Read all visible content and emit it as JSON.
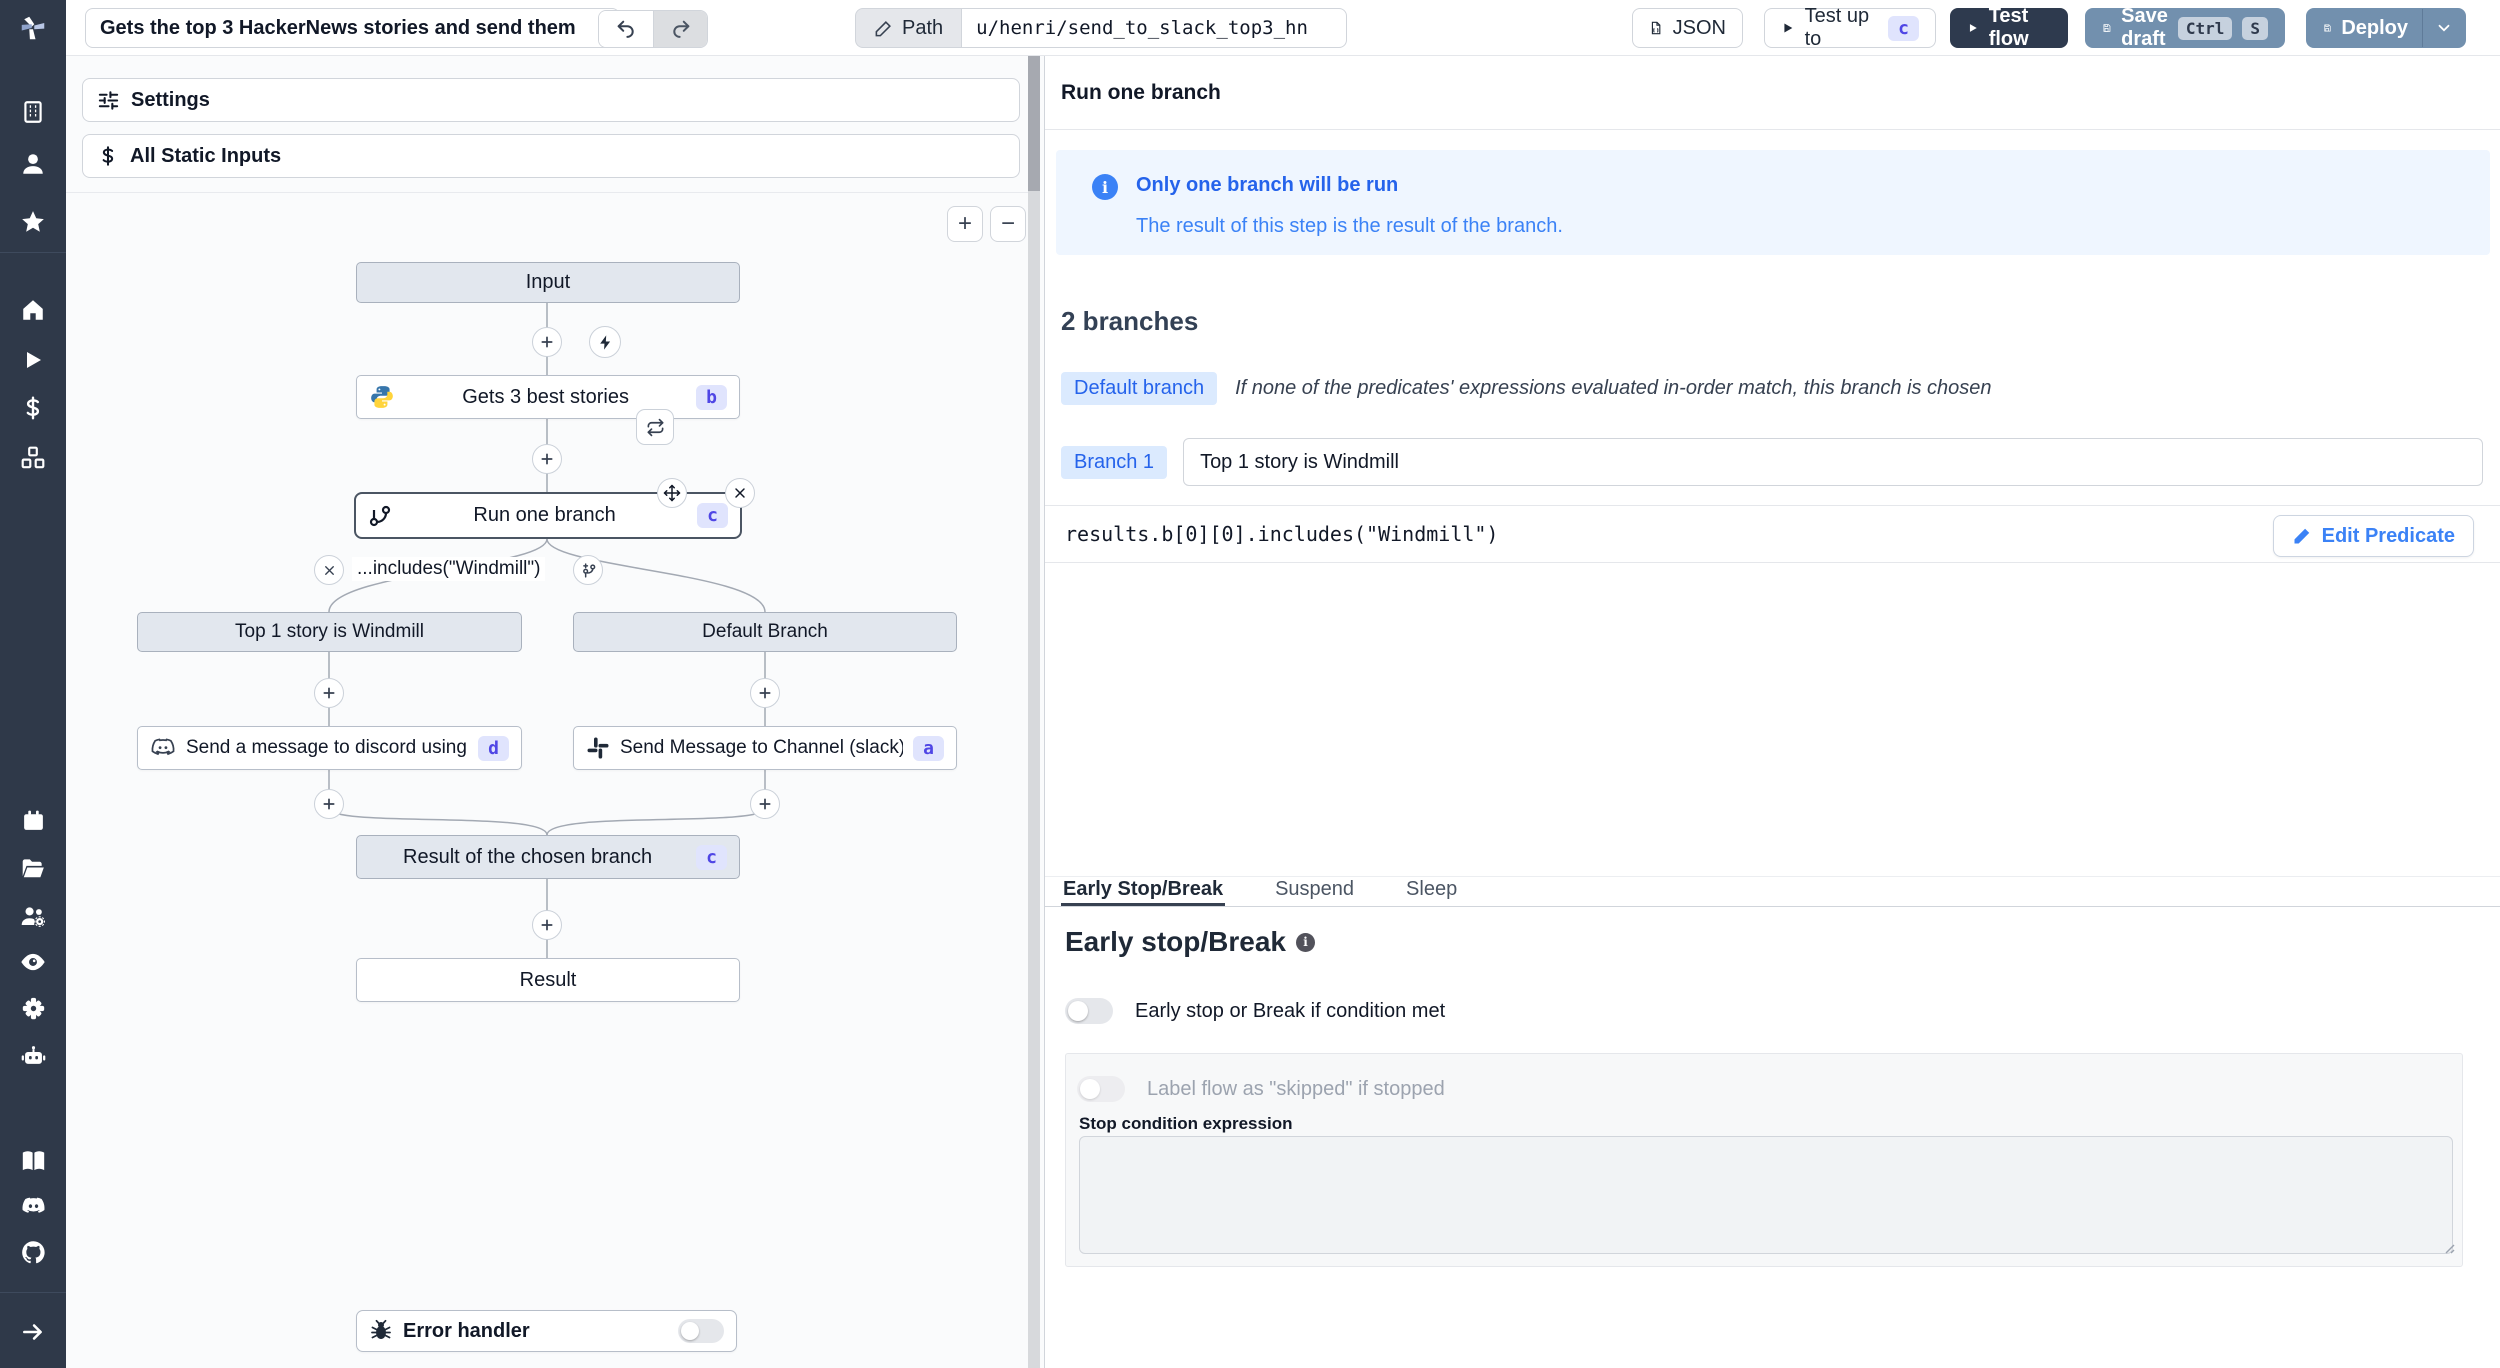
{
  "topbar": {
    "title_value": "Gets the top 3 HackerNews stories and send them",
    "path_label": "Path",
    "path_value": "u/henri/send_to_slack_top3_hn",
    "json_label": "JSON",
    "test_up_to_label": "Test up to",
    "test_up_to_badge": "c",
    "test_flow_label": "Test flow",
    "save_draft_label": "Save draft",
    "kbd_ctrl": "Ctrl",
    "kbd_s": "S",
    "deploy_label": "Deploy"
  },
  "flow": {
    "settings_label": "Settings",
    "static_inputs_label": "All Static Inputs",
    "zoom_in": "+",
    "zoom_out": "−",
    "edge_label": "...includes(\"Windmill\")",
    "error_handler_label": "Error handler",
    "nodes": {
      "input": {
        "label": "Input"
      },
      "get_stories": {
        "label": "Gets 3 best stories",
        "badge": "b"
      },
      "run_one_branch": {
        "label": "Run one branch",
        "badge": "c"
      },
      "branch_windmill": {
        "label": "Top 1 story is Windmill"
      },
      "branch_default": {
        "label": "Default Branch"
      },
      "discord": {
        "label": "Send a message to discord using w...",
        "badge": "d"
      },
      "slack": {
        "label": "Send Message to Channel (slack)",
        "badge": "a"
      },
      "result_chosen": {
        "label": "Result of the chosen branch",
        "badge": "c"
      },
      "result": {
        "label": "Result"
      }
    }
  },
  "panel": {
    "title": "Run one branch",
    "info": {
      "title": "Only one branch will be run",
      "body": "The result of this step is the result of the branch."
    },
    "branches_heading": "2 branches",
    "default_branch": {
      "badge": "Default branch",
      "desc": "If none of the predicates' expressions evaluated in-order match, this branch is chosen"
    },
    "branch1": {
      "badge": "Branch 1",
      "value": "Top 1 story is Windmill"
    },
    "predicate": {
      "code": "results.b[0][0].includes(\"Windmill\")",
      "edit_label": "Edit Predicate"
    },
    "tabs": {
      "early": "Early Stop/Break",
      "suspend": "Suspend",
      "sleep": "Sleep"
    },
    "early_stop": {
      "heading": "Early stop/Break",
      "toggle1": "Early stop or Break if condition met",
      "toggle2": "Label flow as \"skipped\" if stopped",
      "stop_condition_label": "Stop condition expression"
    }
  },
  "colors": {
    "sidebar": "#2f3949",
    "accent_blue": "#3b82f6",
    "badge_bg": "#e0e4fd",
    "badge_text": "#4f46e5",
    "slate_button": "#7290ae",
    "dark_button": "#2e3a4e",
    "info_bg": "#eff6ff"
  }
}
